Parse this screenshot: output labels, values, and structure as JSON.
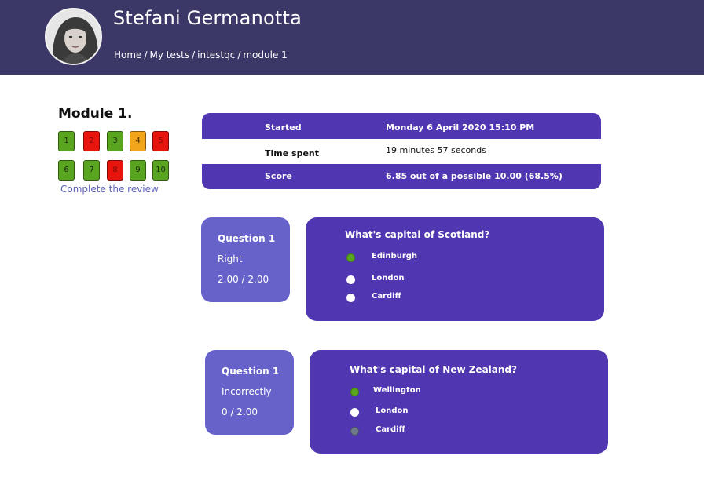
{
  "header": {
    "user_name": "Stefani Germanotta",
    "breadcrumb": [
      "Home",
      "My tests",
      "intestqc",
      "module 1"
    ],
    "breadcrumb_separator": "/",
    "background_color": "#3b3868"
  },
  "sidebar": {
    "module_title": "Module 1.",
    "questions": [
      {
        "label": "1",
        "status": "right",
        "color": "#5aa51f"
      },
      {
        "label": "2",
        "status": "wrong",
        "color": "#e8150f"
      },
      {
        "label": "3",
        "status": "right",
        "color": "#5aa51f"
      },
      {
        "label": "4",
        "status": "partial",
        "color": "#f2a41a"
      },
      {
        "label": "5",
        "status": "wrong",
        "color": "#e8150f"
      },
      {
        "label": "6",
        "status": "right",
        "color": "#5aa51f"
      },
      {
        "label": "7",
        "status": "right",
        "color": "#5aa51f"
      },
      {
        "label": "8",
        "status": "wrong",
        "color": "#e8150f"
      },
      {
        "label": "9",
        "status": "right",
        "color": "#5aa51f"
      },
      {
        "label": "10",
        "status": "right",
        "color": "#5aa51f"
      }
    ],
    "review_link": "Complete the review"
  },
  "summary": {
    "rows": [
      {
        "label": "Started",
        "value": "Monday 6 April 2020 15:10 PM"
      },
      {
        "label": "Time spent",
        "value": "19 minutes 57 seconds"
      },
      {
        "label": "Score",
        "value": "6.85 out of a possible 10.00 (68.5%)"
      }
    ],
    "accent_color": "#5037b1"
  },
  "questions": [
    {
      "title": "Question 1",
      "status": "Right",
      "score": "2.00 / 2.00",
      "question": "What's capital of Scotland?",
      "options": [
        {
          "label": "Edinburgh",
          "state": "correct"
        },
        {
          "label": "London",
          "state": "unselected"
        },
        {
          "label": "Cardiff",
          "state": "unselected"
        }
      ]
    },
    {
      "title": "Question 1",
      "status": "Incorrectly",
      "score": "0 / 2.00",
      "question": "What's capital of New Zealand?",
      "options": [
        {
          "label": "Wellington",
          "state": "correct"
        },
        {
          "label": "London",
          "state": "unselected"
        },
        {
          "label": "Cardiff",
          "state": "selected-wrong"
        }
      ]
    }
  ],
  "colors": {
    "card_light": "#6662c9",
    "card_dark": "#5037b1",
    "correct": "#5aa51f",
    "wrong": "#e8150f",
    "partial": "#f2a41a",
    "wrong_selected": "#6f7a8a"
  }
}
